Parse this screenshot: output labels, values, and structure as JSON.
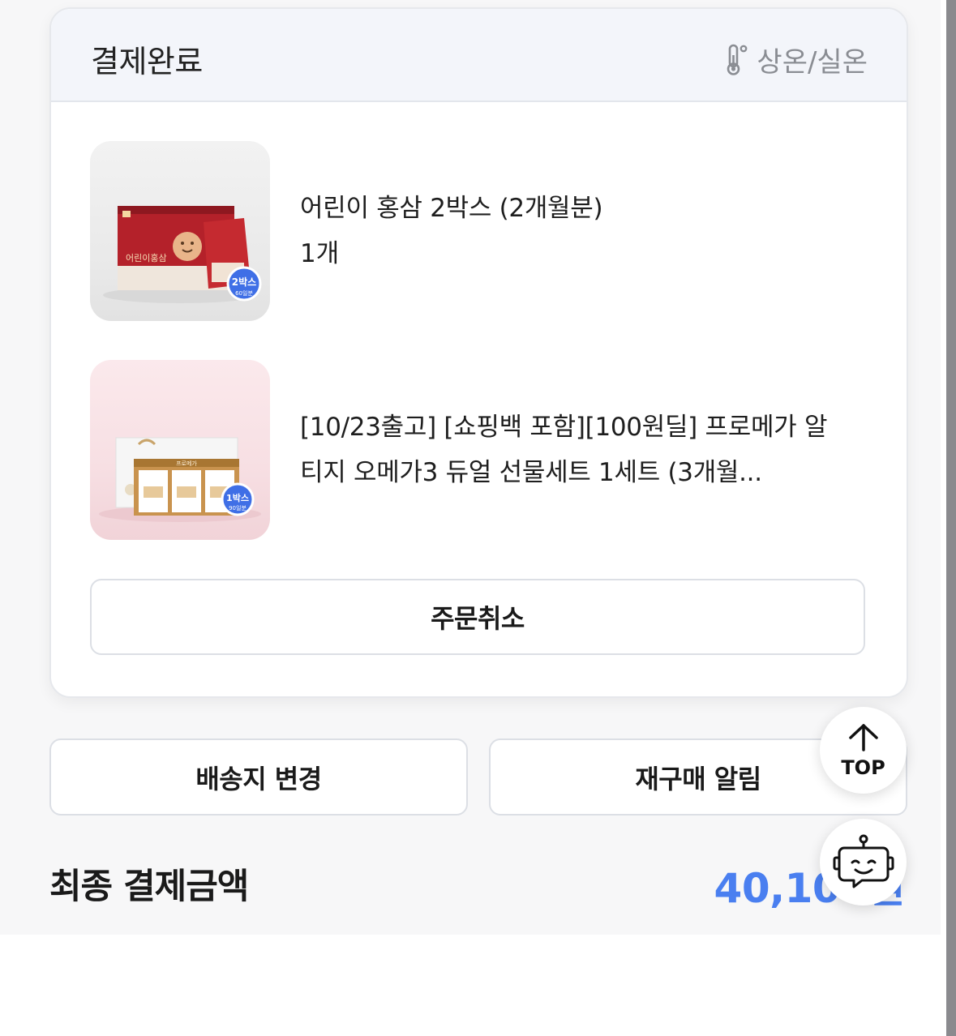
{
  "order": {
    "status": "결제완료",
    "storage_label": "상온/실온",
    "storage_icon": "thermometer-icon",
    "products": [
      {
        "name": "어린이 홍삼 2박스 (2개월분)",
        "quantity": "1개",
        "image": {
          "brand": "어린이홍삼",
          "badge_count": "2박스",
          "badge_sub": "60일분"
        }
      },
      {
        "name": "[10/23출고] [쇼핑백 포함][100원딜] 프로메가 알티지 오메가3 듀얼 선물세트 1세트 (3개월...",
        "quantity": "",
        "image": {
          "brand": "프로메가",
          "badge_count": "1박스",
          "badge_sub": "90일분"
        }
      }
    ],
    "cancel_label": "주문취소"
  },
  "actions": {
    "change_address_label": "배송지 변경",
    "repurchase_alert_label": "재구매 알림"
  },
  "total": {
    "label": "최종 결제금액",
    "amount": "40,100원"
  },
  "floating": {
    "top_label": "TOP",
    "top_icon": "arrow-up-icon",
    "chatbot_icon": "chatbot-icon"
  },
  "colors": {
    "accent_blue": "#4a7ff0",
    "header_bg": "#f3f5fa",
    "badge_blue": "#3f6fe6",
    "ginseng_red": "#b4212a"
  }
}
